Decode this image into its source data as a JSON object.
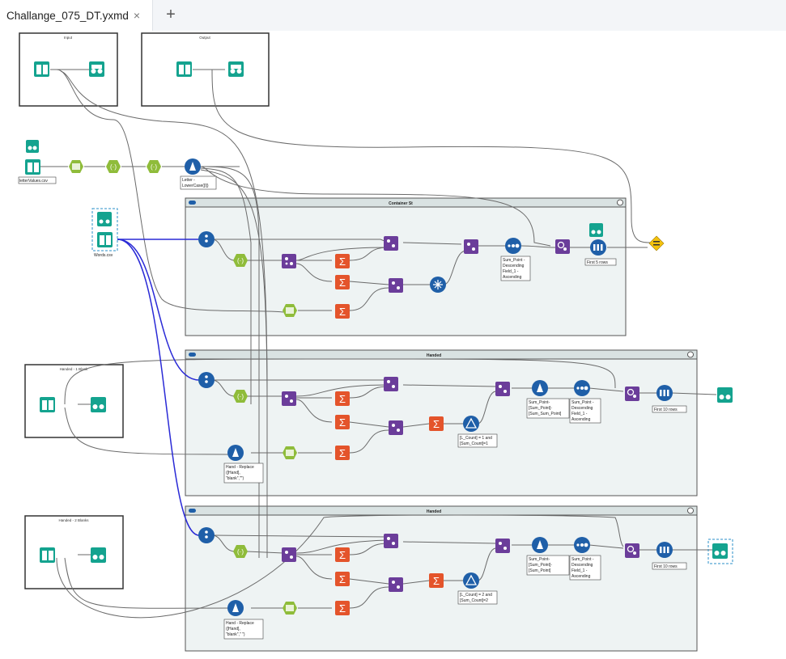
{
  "tab": {
    "title": "Challange_075_DT.yxmd",
    "close": "×",
    "add": "+"
  },
  "boxes": {
    "input": "Input",
    "output": "Output",
    "handed1": "Handed - 1 Blank",
    "handed2": "Handed - 2 Blanks"
  },
  "containers": {
    "c1": "Container St",
    "c2": "Handed",
    "c3": "Handed"
  },
  "annotations": {
    "letter_values": "letterValues.csv",
    "words": "Words.csv",
    "letter_lower": [
      "Letter -",
      "LowerCase([l])"
    ],
    "sort1": [
      "Sum_Point -",
      "Descending",
      "Field_1 -",
      "Ascending"
    ],
    "first5": "First 5 rows",
    "hand1": [
      "Hand - Replace",
      "([Hand],",
      "\"blank\",\"\")"
    ],
    "hand2": [
      "Hand - Replace",
      "([Hand],",
      "\"blank\",\"  \")"
    ],
    "filt1": [
      "[L_Count] = 1 and",
      "[Sum_Count]=1"
    ],
    "filt2": [
      "[L_Count] = 2 and",
      "[Sum_Count]=2"
    ],
    "formula_sp": [
      "Sum_Point-",
      "[Sum_Point]-",
      "[Sum_Sum_Point]"
    ],
    "formula_sp2": [
      "Sum_Point-",
      "[Sum_Point]-",
      "[Sum_Point]"
    ],
    "sort2": [
      "Sum_Point -",
      "Descending",
      "Field_1 -",
      "Ascending"
    ],
    "first10": "First 10 rows"
  },
  "colors": {
    "teal": "#14a38f",
    "lime": "#8fbc3a",
    "purple": "#6b3d9a",
    "orange": "#e4542b",
    "blue": "#1f5fa8",
    "yellow": "#f4c20d",
    "container_bg": "#eef3f3",
    "selected_wire": "#2a2ad6"
  }
}
